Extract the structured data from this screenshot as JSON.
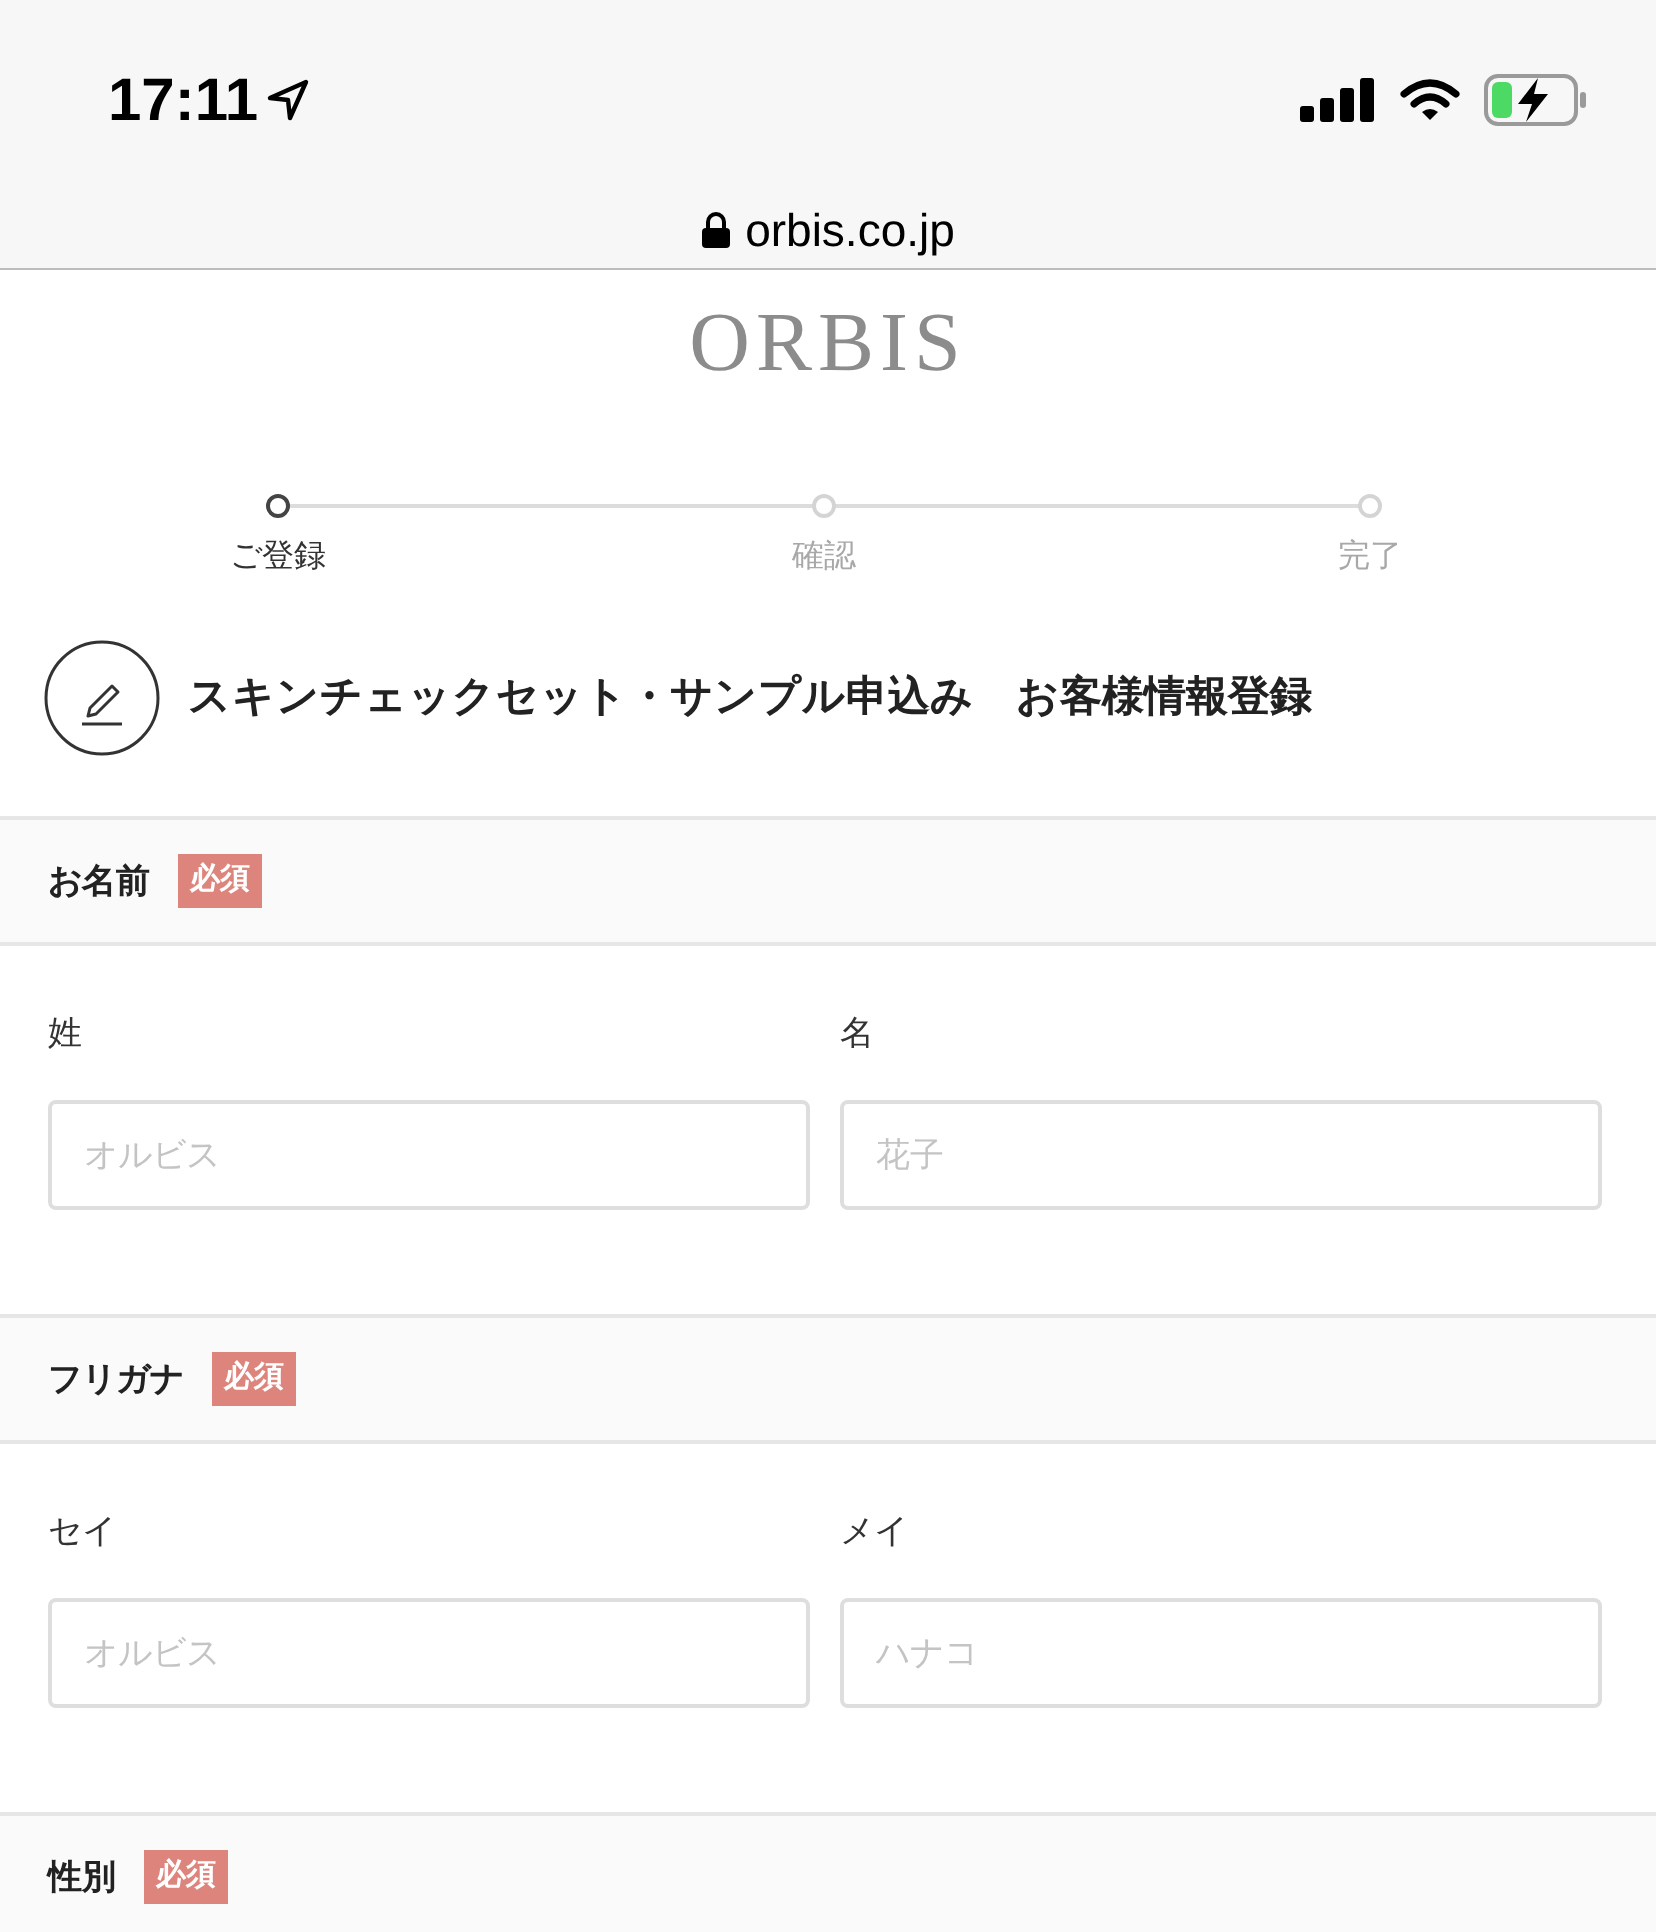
{
  "status_bar": {
    "time": "17:11",
    "url": "orbis.co.jp"
  },
  "logo": "ORBIS",
  "steps": [
    {
      "label": "ご登録",
      "selected": true
    },
    {
      "label": "確認",
      "selected": false
    },
    {
      "label": "完了",
      "selected": false
    }
  ],
  "page_title": "スキンチェックセット・サンプル申込み　お客様情報登録",
  "sections": [
    {
      "label": "お名前",
      "badge": "必須",
      "fields": [
        {
          "label": "姓",
          "placeholder": "オルビス"
        },
        {
          "label": "名",
          "placeholder": "花子"
        }
      ]
    },
    {
      "label": "フリガナ",
      "badge": "必須",
      "fields": [
        {
          "label": "セイ",
          "placeholder": "オルビス"
        },
        {
          "label": "メイ",
          "placeholder": "ハナコ"
        }
      ]
    },
    {
      "label": "性別",
      "badge": "必須"
    }
  ]
}
